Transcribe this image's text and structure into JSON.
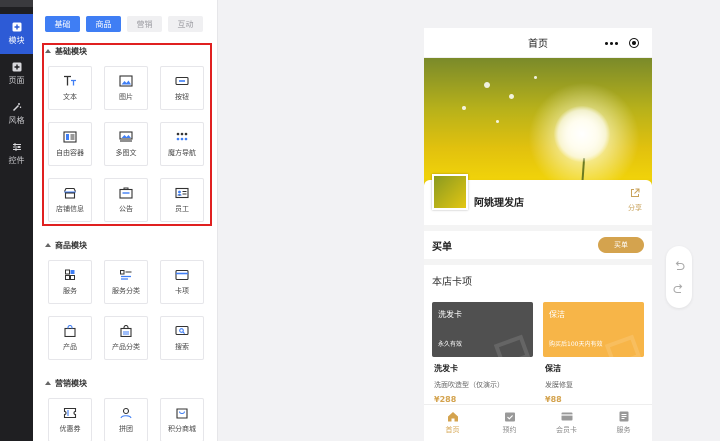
{
  "rail": {
    "items": [
      {
        "label": "模块",
        "icon": "plus-square-icon",
        "active": true
      },
      {
        "label": "页面",
        "icon": "plus-square-icon"
      },
      {
        "label": "风格",
        "icon": "magic-wand-icon"
      },
      {
        "label": "控件",
        "icon": "sliders-icon"
      }
    ]
  },
  "tabs": [
    {
      "label": "基础"
    },
    {
      "label": "商品",
      "active": true
    },
    {
      "label": "营销"
    },
    {
      "label": "互动"
    }
  ],
  "sections": {
    "basic": {
      "title": "基础模块",
      "items": [
        {
          "label": "文本",
          "icon": "text-icon"
        },
        {
          "label": "图片",
          "icon": "image-icon"
        },
        {
          "label": "按钮",
          "icon": "button-icon"
        },
        {
          "label": "自由容器",
          "icon": "container-icon"
        },
        {
          "label": "多图文",
          "icon": "multi-image-icon"
        },
        {
          "label": "魔方导航",
          "icon": "grid-dots-icon"
        },
        {
          "label": "店铺信息",
          "icon": "store-icon"
        },
        {
          "label": "公告",
          "icon": "notice-icon"
        },
        {
          "label": "员工",
          "icon": "staff-card-icon"
        }
      ]
    },
    "goods": {
      "title": "商品模块",
      "items": [
        {
          "label": "服务",
          "icon": "service-grid-icon"
        },
        {
          "label": "服务分类",
          "icon": "category-list-icon"
        },
        {
          "label": "卡项",
          "icon": "card-icon"
        },
        {
          "label": "产品",
          "icon": "bag-icon"
        },
        {
          "label": "产品分类",
          "icon": "bag-category-icon"
        },
        {
          "label": "搜索",
          "icon": "search-box-icon"
        }
      ]
    },
    "marketing": {
      "title": "营销模块",
      "items": [
        {
          "label": "优惠券",
          "icon": "coupon-icon"
        },
        {
          "label": "拼团",
          "icon": "group-buy-icon"
        },
        {
          "label": "积分商城",
          "icon": "points-mall-icon"
        }
      ]
    }
  },
  "preview": {
    "title": "首页",
    "store_name": "阿姚理发店",
    "share_label": "分享",
    "buy_title": "买单",
    "buy_button": "买单",
    "cards_title": "本店卡项",
    "cards": [
      {
        "name": "洗发卡",
        "validity": "永久有效",
        "title": "洗发卡",
        "desc": "洗面吹造型（仅演示）",
        "price": "¥288",
        "color": "#505050"
      },
      {
        "name": "保洁",
        "validity": "购买后100天内有效",
        "title": "保洁",
        "desc": "发膜修复",
        "price": "¥88",
        "color": "#f7b548"
      }
    ],
    "tabbar": [
      {
        "label": "首页",
        "icon": "home-icon",
        "active": true
      },
      {
        "label": "预约",
        "icon": "calendar-check-icon"
      },
      {
        "label": "会员卡",
        "icon": "member-card-icon"
      },
      {
        "label": "服务",
        "icon": "service-list-icon"
      }
    ]
  },
  "colors": {
    "accent": "#3f7ef4",
    "rail_bg": "#1f1f22",
    "rail_active": "#2d5bd6",
    "gold": "#d4a34e",
    "highlight_border": "#e02020"
  }
}
